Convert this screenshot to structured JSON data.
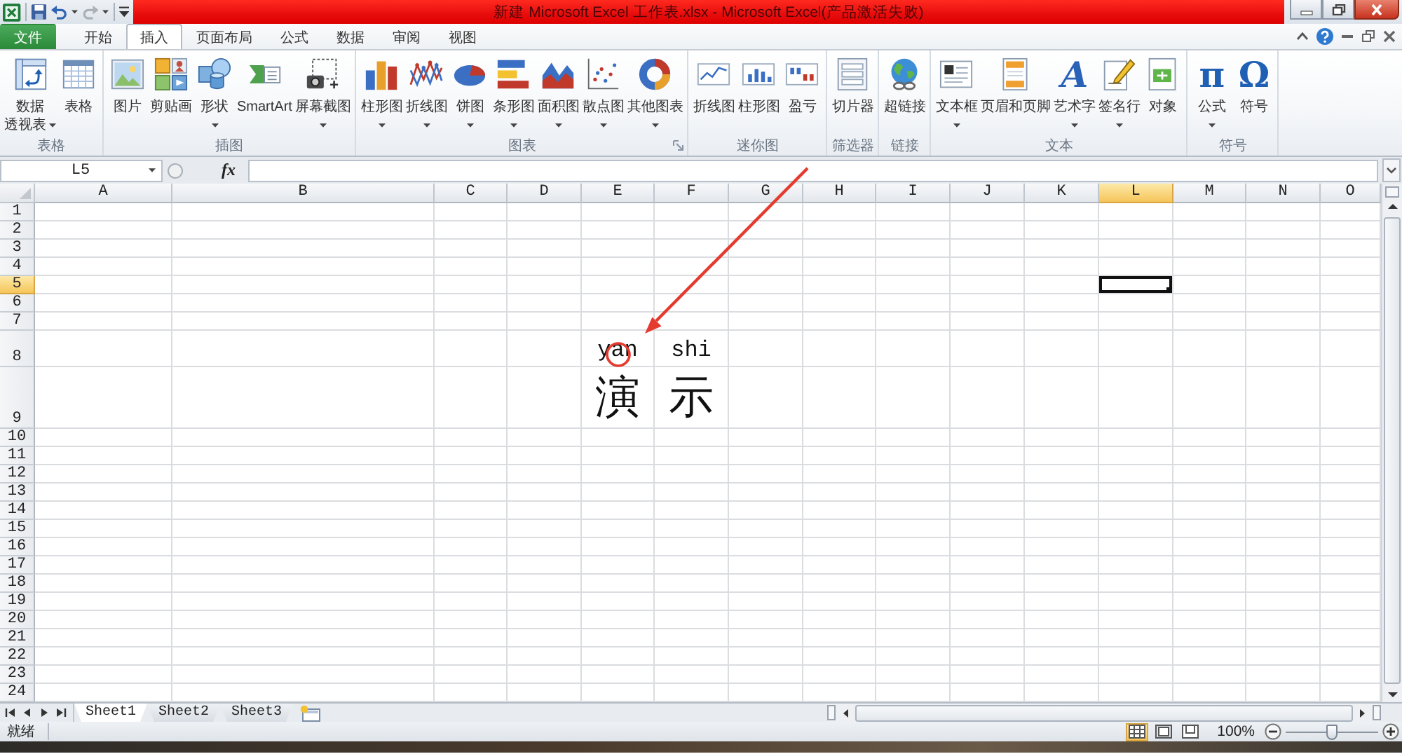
{
  "window": {
    "title": "新建 Microsoft Excel 工作表.xlsx - Microsoft Excel(产品激活失败)"
  },
  "quick_access": [
    {
      "disabled": false
    },
    {
      "disabled": false
    },
    {
      "disabled": true
    }
  ],
  "ribbon_tabs": [
    {
      "label": "文件",
      "kind": "file",
      "selected": false
    },
    {
      "label": "开始",
      "kind": "tab",
      "selected": false
    },
    {
      "label": "插入",
      "kind": "tab",
      "selected": true
    },
    {
      "label": "页面布局",
      "kind": "tab",
      "selected": false
    },
    {
      "label": "公式",
      "kind": "tab",
      "selected": false
    },
    {
      "label": "数据",
      "kind": "tab",
      "selected": false
    },
    {
      "label": "审阅",
      "kind": "tab",
      "selected": false
    },
    {
      "label": "视图",
      "kind": "tab",
      "selected": false
    }
  ],
  "ribbon_groups": [
    {
      "label": "表格",
      "buttons": [
        {
          "lines": [
            "数据",
            "透视表"
          ],
          "dropdown": true
        },
        {
          "lines": [
            "表格"
          ]
        }
      ]
    },
    {
      "label": "插图",
      "buttons": [
        {
          "lines": [
            "图片"
          ]
        },
        {
          "lines": [
            "剪贴画"
          ]
        },
        {
          "lines": [
            "形状"
          ],
          "dropdown": true
        },
        {
          "lines": [
            "SmartArt"
          ]
        },
        {
          "lines": [
            "屏幕截图"
          ],
          "dropdown": true
        }
      ]
    },
    {
      "label": "图表",
      "launcher": true,
      "buttons": [
        {
          "lines": [
            "柱形图"
          ],
          "dropdown": true
        },
        {
          "lines": [
            "折线图"
          ],
          "dropdown": true
        },
        {
          "lines": [
            "饼图"
          ],
          "dropdown": true
        },
        {
          "lines": [
            "条形图"
          ],
          "dropdown": true
        },
        {
          "lines": [
            "面积图"
          ],
          "dropdown": true
        },
        {
          "lines": [
            "散点图"
          ],
          "dropdown": true
        },
        {
          "lines": [
            "其他图表"
          ],
          "dropdown": true
        }
      ]
    },
    {
      "label": "迷你图",
      "buttons": [
        {
          "lines": [
            "折线图"
          ]
        },
        {
          "lines": [
            "柱形图"
          ]
        },
        {
          "lines": [
            "盈亏"
          ]
        }
      ]
    },
    {
      "label": "筛选器",
      "buttons": [
        {
          "lines": [
            "切片器"
          ]
        }
      ]
    },
    {
      "label": "链接",
      "buttons": [
        {
          "lines": [
            "超链接"
          ]
        }
      ]
    },
    {
      "label": "文本",
      "buttons": [
        {
          "lines": [
            "文本框"
          ],
          "dropdown": true
        },
        {
          "lines": [
            "页眉和页脚"
          ]
        },
        {
          "lines": [
            "艺术字"
          ],
          "dropdown": true,
          "glyph": "A"
        },
        {
          "lines": [
            "签名行"
          ],
          "dropdown": true
        },
        {
          "lines": [
            "对象"
          ]
        }
      ]
    },
    {
      "label": "符号",
      "buttons": [
        {
          "lines": [
            "公式"
          ],
          "dropdown": true,
          "glyph": "π"
        },
        {
          "lines": [
            "符号"
          ],
          "glyph": "Ω"
        }
      ]
    }
  ],
  "name_box": "L5",
  "function_button": "fx",
  "columns": [
    {
      "label": "A",
      "selected": false
    },
    {
      "label": "B",
      "selected": false
    },
    {
      "label": "C",
      "selected": false
    },
    {
      "label": "D",
      "selected": false
    },
    {
      "label": "E",
      "selected": false
    },
    {
      "label": "F",
      "selected": false
    },
    {
      "label": "G",
      "selected": false
    },
    {
      "label": "H",
      "selected": false
    },
    {
      "label": "I",
      "selected": false
    },
    {
      "label": "J",
      "selected": false
    },
    {
      "label": "K",
      "selected": false
    },
    {
      "label": "L",
      "selected": true
    },
    {
      "label": "M",
      "selected": false
    },
    {
      "label": "N",
      "selected": false
    },
    {
      "label": "O",
      "selected": false
    }
  ],
  "rows": [
    {
      "label": "1",
      "selected": false
    },
    {
      "label": "2",
      "selected": false
    },
    {
      "label": "3",
      "selected": false
    },
    {
      "label": "4",
      "selected": false
    },
    {
      "label": "5",
      "selected": true
    },
    {
      "label": "6",
      "selected": false
    },
    {
      "label": "7",
      "selected": false
    },
    {
      "label": "8",
      "selected": false,
      "cells": [
        {},
        {},
        {},
        {},
        {
          "text": "yan",
          "kind": "phonetic"
        },
        {
          "text": "shi",
          "kind": "phonetic"
        }
      ]
    },
    {
      "label": "9",
      "selected": false,
      "cells": [
        {},
        {},
        {},
        {},
        {
          "text": "演",
          "kind": "large"
        },
        {
          "text": "示",
          "kind": "large"
        }
      ]
    },
    {
      "label": "10",
      "selected": false
    },
    {
      "label": "11",
      "selected": false
    },
    {
      "label": "12",
      "selected": false
    },
    {
      "label": "13",
      "selected": false
    },
    {
      "label": "14",
      "selected": false
    },
    {
      "label": "15",
      "selected": false
    },
    {
      "label": "16",
      "selected": false
    },
    {
      "label": "17",
      "selected": false
    },
    {
      "label": "18",
      "selected": false
    },
    {
      "label": "19",
      "selected": false
    },
    {
      "label": "20",
      "selected": false
    },
    {
      "label": "21",
      "selected": false
    },
    {
      "label": "22",
      "selected": false
    },
    {
      "label": "23",
      "selected": false
    },
    {
      "label": "24",
      "selected": false
    }
  ],
  "sheet_tabs": [
    {
      "label": "Sheet1",
      "selected": true
    },
    {
      "label": "Sheet2",
      "selected": false
    },
    {
      "label": "Sheet3",
      "selected": false
    }
  ],
  "status_bar": {
    "text": "就绪",
    "views": [
      {
        "selected": true
      },
      {
        "selected": false
      },
      {
        "selected": false
      }
    ],
    "zoom": "100%",
    "zoom_slider": {
      "level": 0.5
    }
  }
}
